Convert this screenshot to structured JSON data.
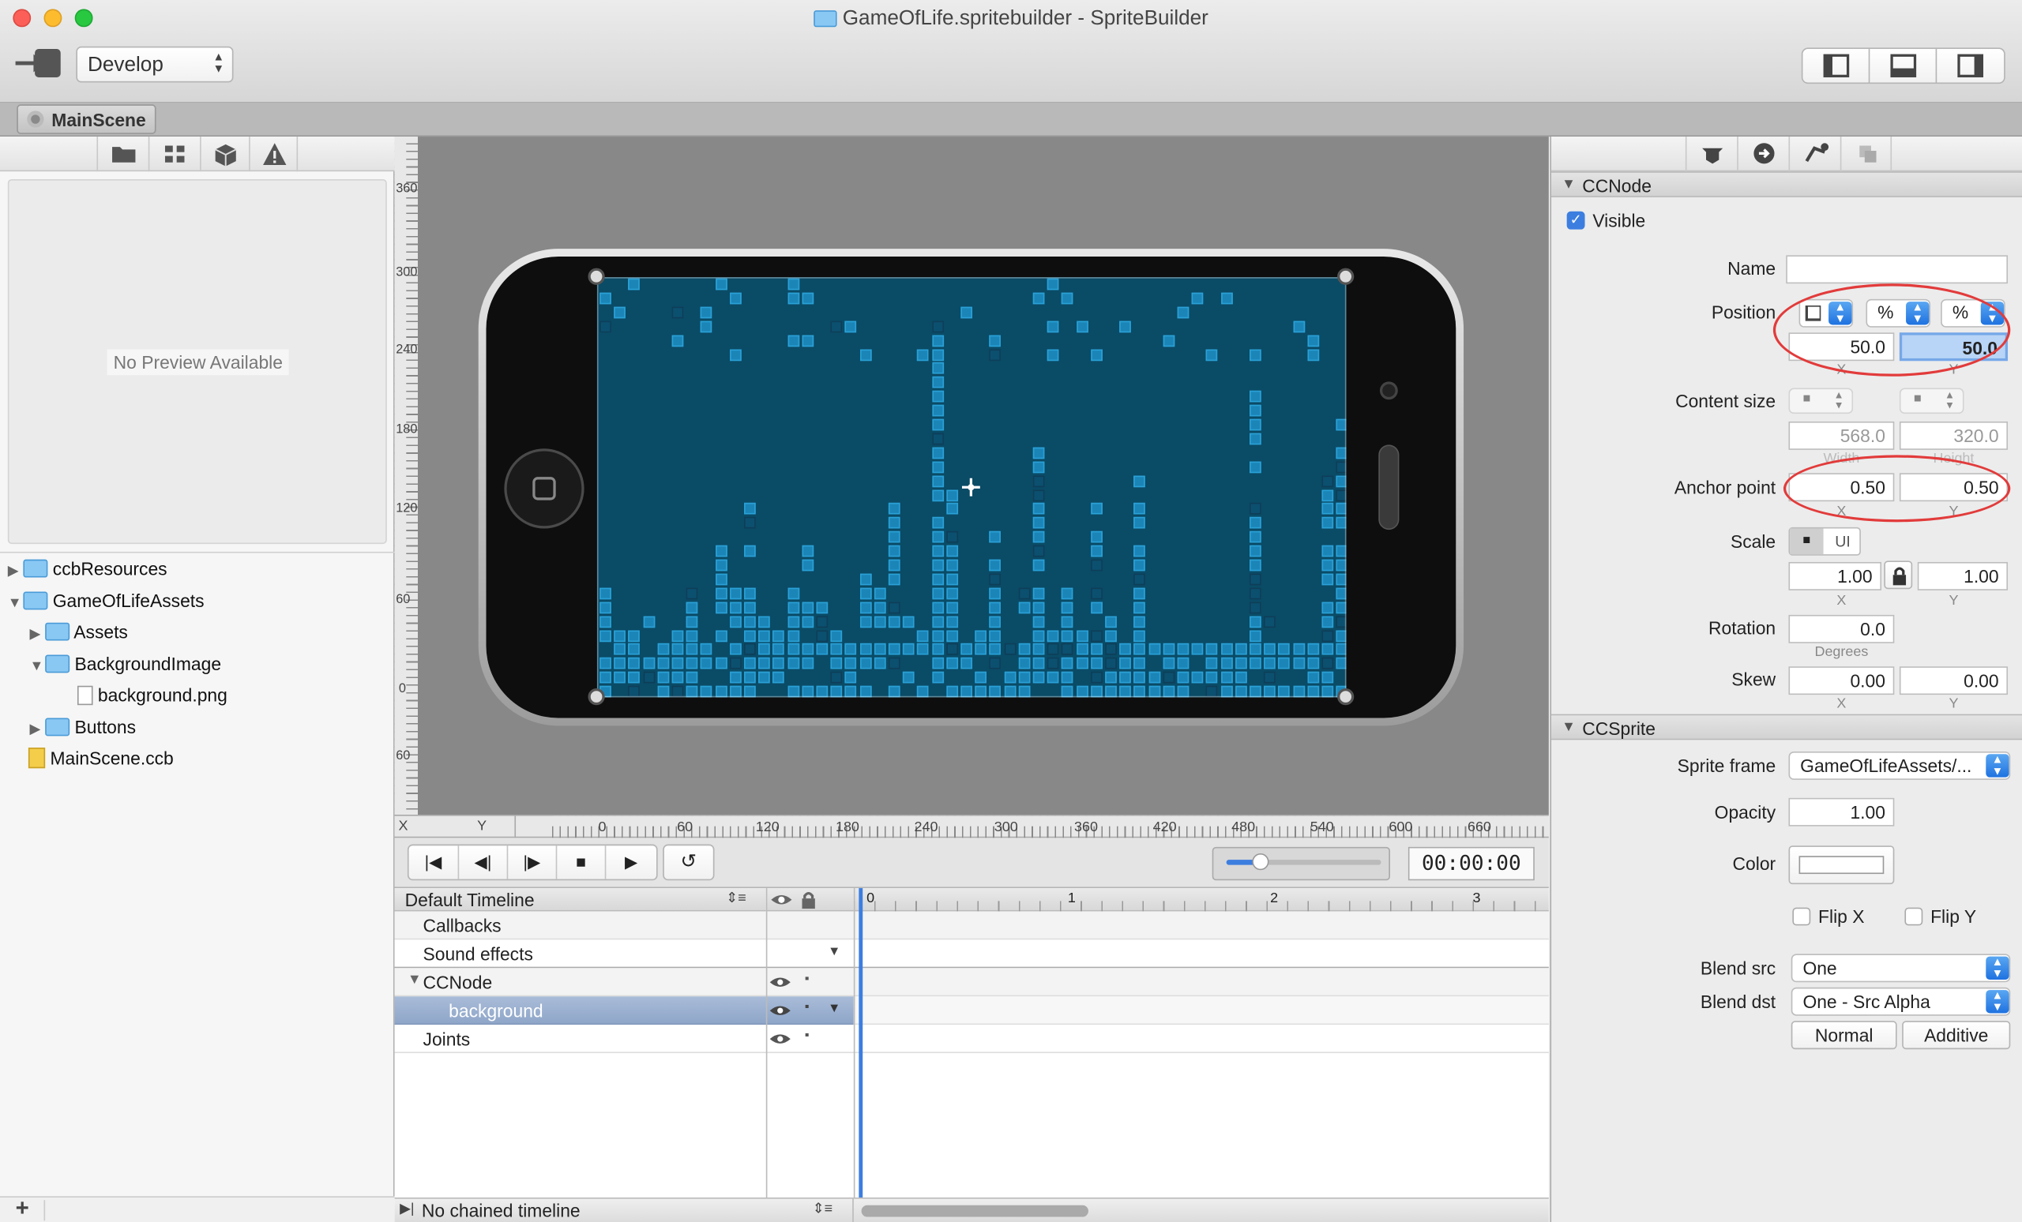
{
  "window": {
    "title": "GameOfLife.spritebuilder - SpriteBuilder"
  },
  "toolbar": {
    "publish_icon": "publish-arrow-icon",
    "mode": "Develop"
  },
  "tabs": [
    {
      "label": "MainScene"
    }
  ],
  "left": {
    "preview_text": "No Preview Available",
    "tree": [
      {
        "label": "ccbResources",
        "type": "folder"
      },
      {
        "label": "GameOfLifeAssets",
        "type": "folder"
      },
      {
        "label": "Assets",
        "type": "folder"
      },
      {
        "label": "BackgroundImage",
        "type": "folder"
      },
      {
        "label": "background.png",
        "type": "image-file"
      },
      {
        "label": "Buttons",
        "type": "folder"
      },
      {
        "label": "MainScene.ccb",
        "type": "ccb-file"
      }
    ]
  },
  "canvas": {
    "rulers": {
      "x_axis_label": "X",
      "y_axis_label": "Y",
      "x_ticks": [
        "0",
        "60",
        "120",
        "180",
        "240",
        "300",
        "360",
        "420",
        "480",
        "540",
        "600",
        "660"
      ],
      "y_ticks": [
        "360",
        "300",
        "240",
        "180",
        "120",
        "60",
        "0",
        "60"
      ]
    }
  },
  "playback": {
    "time": "00:00:00"
  },
  "timeline": {
    "name": "Default Timeline",
    "ruler": [
      "0",
      "1",
      "2",
      "3"
    ],
    "rows": [
      {
        "label": "Callbacks"
      },
      {
        "label": "Sound effects"
      },
      {
        "label": "CCNode"
      },
      {
        "label": "background"
      },
      {
        "label": "Joints"
      }
    ],
    "chained": "No chained timeline"
  },
  "inspector": {
    "ccnode": {
      "title": "CCNode",
      "visible_label": "Visible",
      "name_label": "Name",
      "name_value": "",
      "position_label": "Position",
      "pos_x": "50.0",
      "pos_y": "50.0",
      "pos_unit_x": "%",
      "pos_unit_y": "%",
      "x_label": "X",
      "y_label": "Y",
      "content_size_label": "Content size",
      "width": "568.0",
      "height": "320.0",
      "width_label": "Width",
      "height_label": "Height",
      "anchor_label": "Anchor point",
      "anchor_x": "0.50",
      "anchor_y": "0.50",
      "scale_label": "Scale",
      "scale_ui": "UI",
      "scale_x": "1.00",
      "scale_y": "1.00",
      "rotation_label": "Rotation",
      "rotation": "0.0",
      "degrees_label": "Degrees",
      "skew_label": "Skew",
      "skew_x": "0.00",
      "skew_y": "0.00"
    },
    "ccsprite": {
      "title": "CCSprite",
      "sprite_frame_label": "Sprite frame",
      "sprite_frame": "GameOfLifeAssets/...",
      "opacity_label": "Opacity",
      "opacity": "1.00",
      "color_label": "Color",
      "flip_x": "Flip X",
      "flip_y": "Flip Y",
      "blend_src_label": "Blend src",
      "blend_src": "One",
      "blend_dst_label": "Blend dst",
      "blend_dst": "One - Src Alpha",
      "normal_btn": "Normal",
      "additive_btn": "Additive"
    }
  },
  "colors": {
    "accent": "#3c7ee0",
    "annotation": "#e23b3b",
    "grid": "#0a4b66",
    "cell": "#1b85b8"
  }
}
